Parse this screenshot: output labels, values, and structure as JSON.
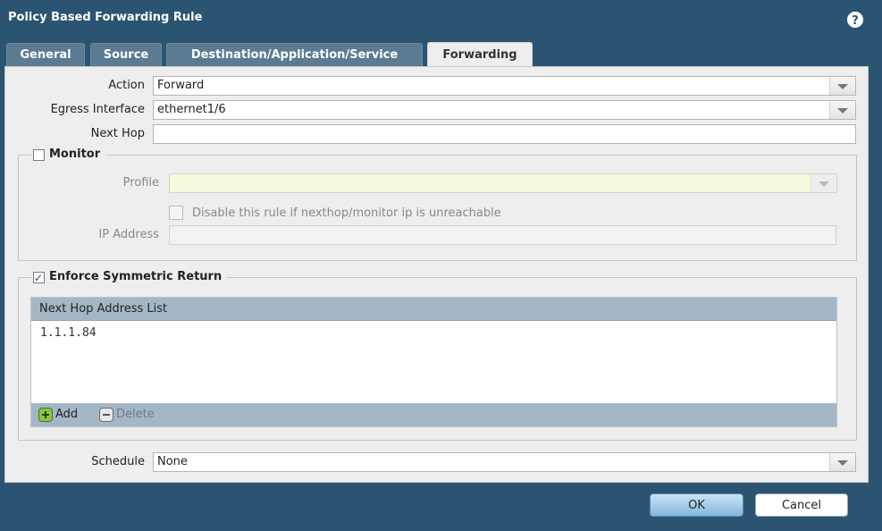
{
  "dialog": {
    "title": "Policy Based Forwarding Rule",
    "help_glyph": "?"
  },
  "tabs": [
    {
      "label": "General"
    },
    {
      "label": "Source"
    },
    {
      "label": "Destination/Application/Service"
    },
    {
      "label": "Forwarding",
      "active": true
    }
  ],
  "form": {
    "action_label": "Action",
    "action_value": "Forward",
    "egress_label": "Egress Interface",
    "egress_value": "ethernet1/6",
    "nexthop_label": "Next Hop",
    "nexthop_value": "",
    "schedule_label": "Schedule",
    "schedule_value": "None"
  },
  "monitor": {
    "legend": "Monitor",
    "checked": false,
    "profile_label": "Profile",
    "profile_value": "",
    "disable_rule_label": "Disable this rule if nexthop/monitor ip is unreachable",
    "disable_rule_checked": false,
    "ip_label": "IP Address",
    "ip_value": ""
  },
  "symmetric": {
    "legend": "Enforce Symmetric Return",
    "checked": true,
    "list_header": "Next Hop Address List",
    "addresses": [
      "1.1.1.84"
    ],
    "add_label": "Add",
    "delete_label": "Delete"
  },
  "buttons": {
    "ok": "OK",
    "cancel": "Cancel"
  },
  "colors": {
    "dialog_bg": "#2b5472",
    "tab_bg": "#5b7b93",
    "panel_bg": "#eeeeee",
    "grid_header_bg": "#a5b7c6"
  },
  "icons": {
    "help": "help-icon",
    "dropdown": "chevron-down-icon",
    "add": "add-icon",
    "delete": "minus-icon"
  }
}
